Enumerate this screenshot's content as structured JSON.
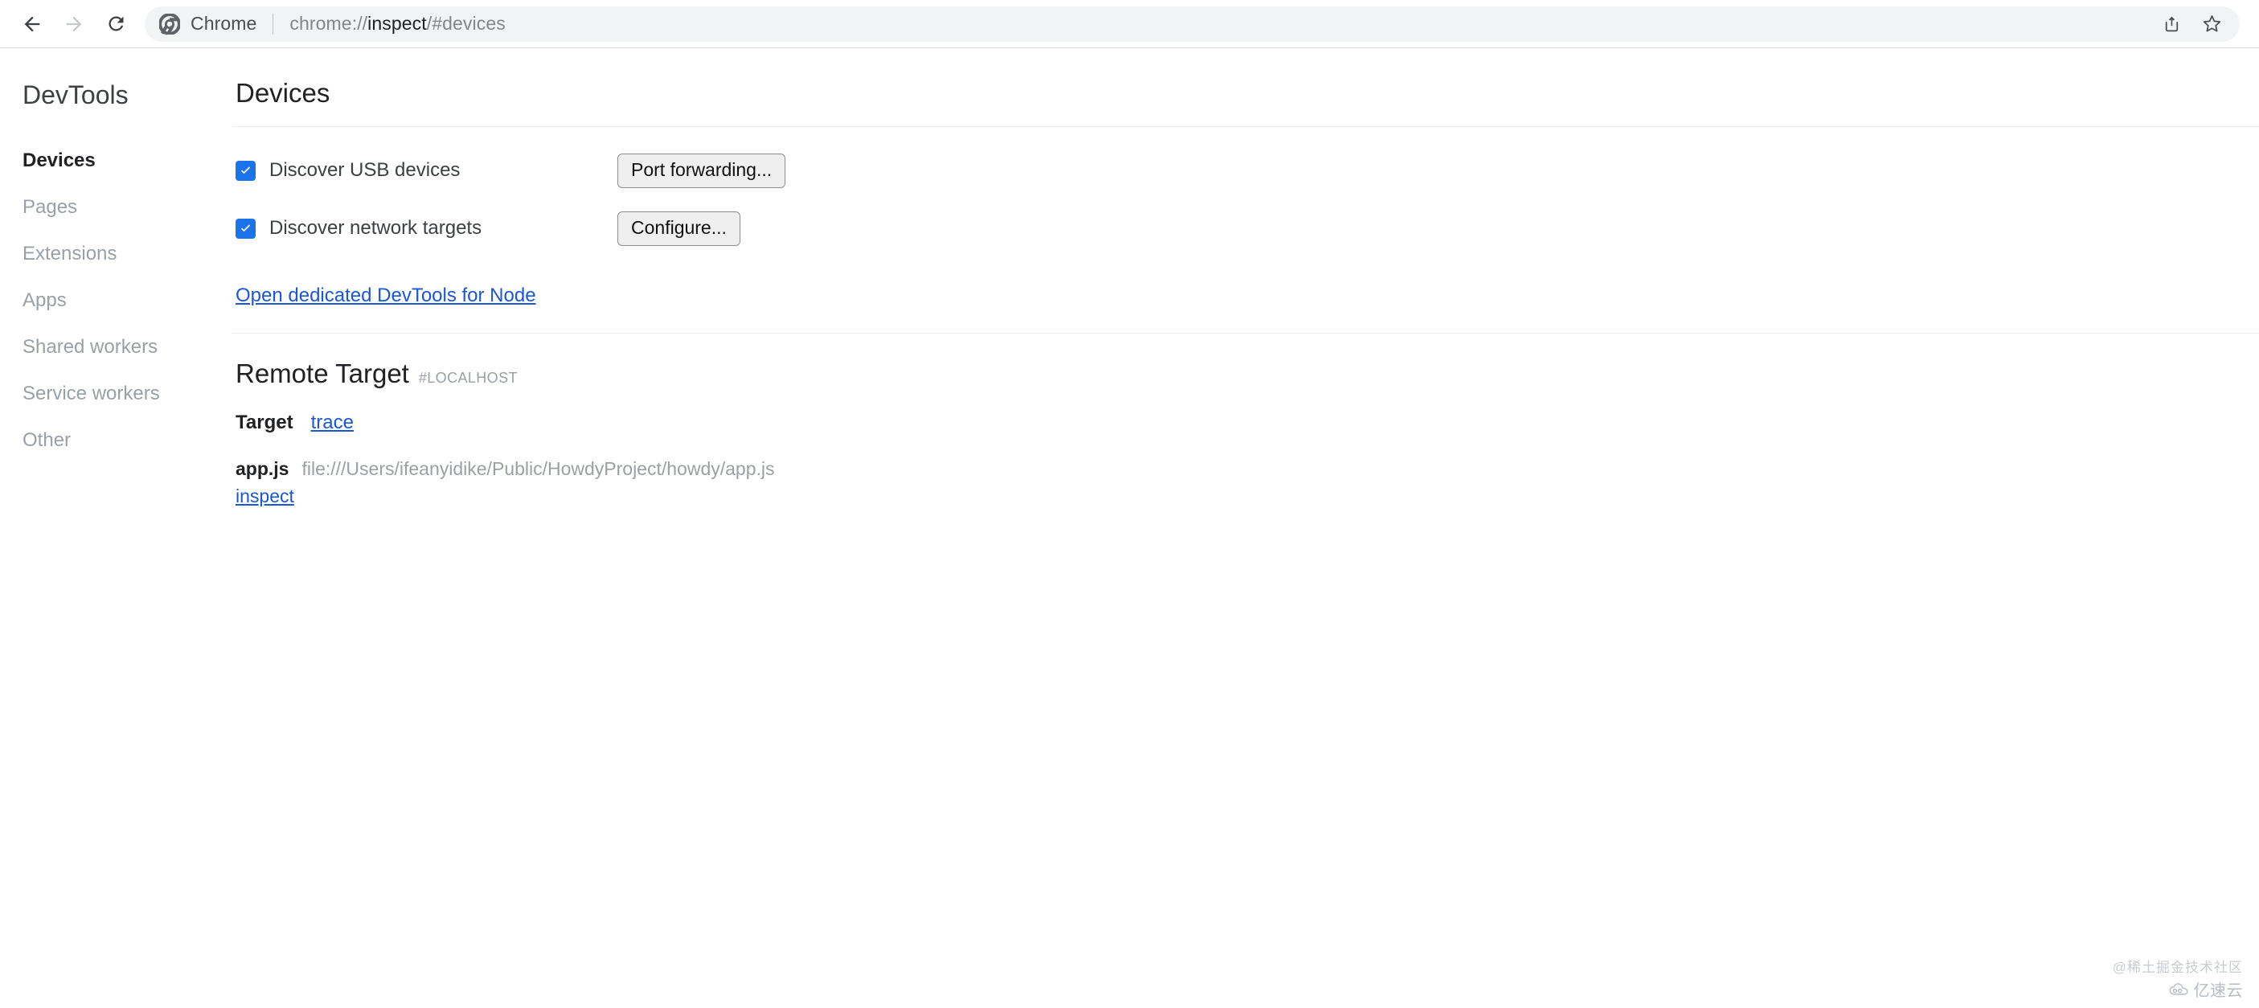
{
  "browser": {
    "back_label": "Back",
    "forward_label": "Forward",
    "reload_label": "Reload",
    "site_name": "Chrome",
    "url_prefix": "chrome://",
    "url_host": "inspect",
    "url_suffix": "/#devices",
    "url_full": "chrome://inspect/#devices",
    "share_label": "Share",
    "bookmark_label": "Bookmark this tab"
  },
  "sidebar": {
    "brand": "DevTools",
    "items": [
      {
        "label": "Devices",
        "active": true
      },
      {
        "label": "Pages",
        "active": false
      },
      {
        "label": "Extensions",
        "active": false
      },
      {
        "label": "Apps",
        "active": false
      },
      {
        "label": "Shared workers",
        "active": false
      },
      {
        "label": "Service workers",
        "active": false
      },
      {
        "label": "Other",
        "active": false
      }
    ]
  },
  "main": {
    "page_title": "Devices",
    "options": [
      {
        "label": "Discover USB devices",
        "checked": true,
        "button": "Port forwarding..."
      },
      {
        "label": "Discover network targets",
        "checked": true,
        "button": "Configure..."
      }
    ],
    "node_link": "Open dedicated DevTools for Node",
    "remote_target": {
      "title": "Remote Target",
      "tag": "#LOCALHOST",
      "target_label": "Target",
      "trace_link": "trace",
      "entries": [
        {
          "name": "app.js",
          "path": "file:///Users/ifeanyidike/Public/HowdyProject/howdy/app.js",
          "inspect_link": "inspect"
        }
      ]
    }
  },
  "watermark": {
    "text": "@稀土掘金技术社区",
    "logo_text": "亿速云"
  },
  "colors": {
    "accent_blue": "#1a73e8",
    "link_blue": "#1a56d6",
    "omnibox_bg": "#f1f3f4",
    "muted_text": "#9aa0a6",
    "primary_text": "#202124"
  }
}
